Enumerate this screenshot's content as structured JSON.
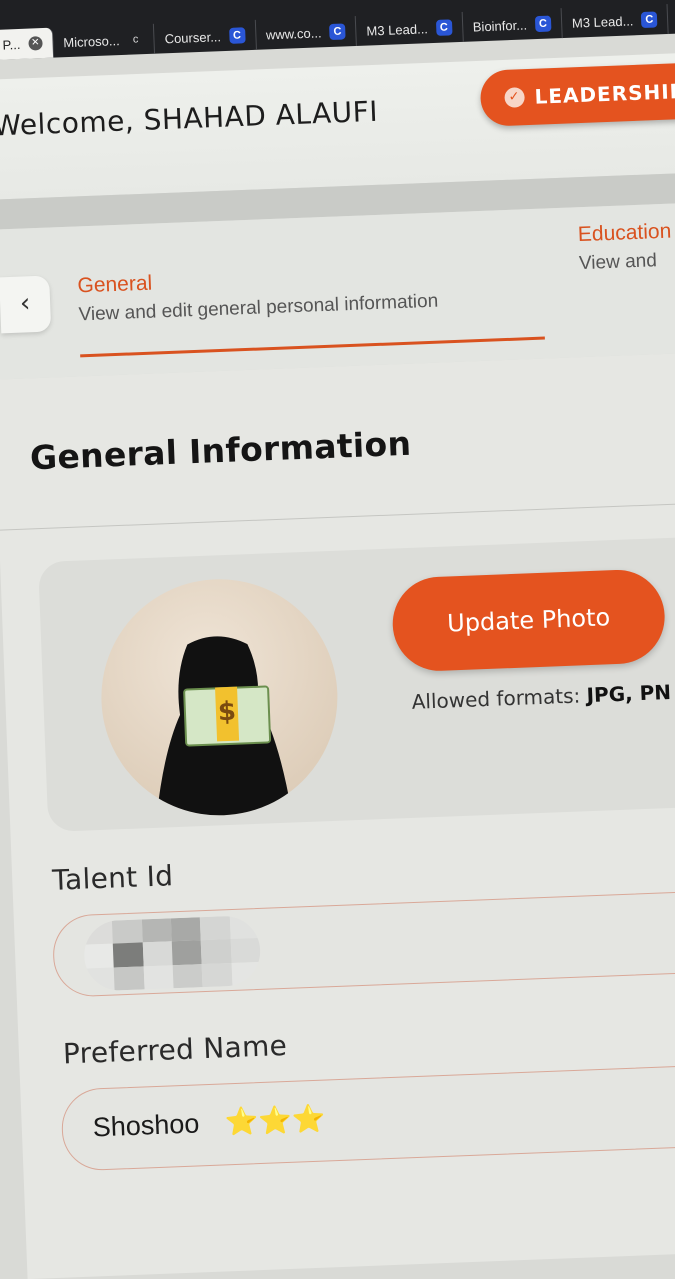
{
  "browser": {
    "tabs": [
      {
        "label": "P...",
        "icon": "close",
        "active": true
      },
      {
        "label": "Microso...",
        "icon": "c"
      },
      {
        "label": "Courser...",
        "icon": "C"
      },
      {
        "label": "www.co...",
        "icon": "C"
      },
      {
        "label": "M3 Lead...",
        "icon": "C"
      },
      {
        "label": "Bioinfor...",
        "icon": "C"
      },
      {
        "label": "M3 Lead...",
        "icon": "C"
      }
    ]
  },
  "header": {
    "welcome": "Welcome, SHAHAD ALAUFI",
    "leadership_button": "LEADERSHIP P"
  },
  "profile_tabs": {
    "general": {
      "title": "General",
      "subtitle": "View and edit general personal information"
    },
    "education": {
      "title": "Education",
      "subtitle": "View and"
    }
  },
  "general_info": {
    "title": "General Information",
    "update_photo_label": "Update Photo",
    "allowed_prefix": "Allowed formats: ",
    "allowed_formats": "JPG, PN",
    "fields": {
      "talent_id": {
        "label": "Talent Id",
        "value": ""
      },
      "preferred_name": {
        "label": "Preferred Name",
        "value": "Shoshoo",
        "emoji": "⭐⭐⭐"
      }
    }
  },
  "colors": {
    "accent": "#e4531f",
    "accent_text": "#d9521f",
    "tabbar": "#1f2023"
  }
}
